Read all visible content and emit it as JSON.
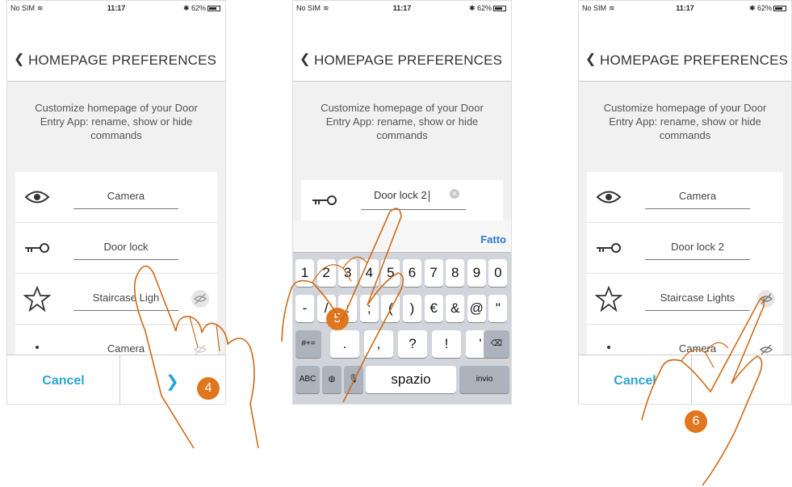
{
  "status": {
    "carrier": "No SIM",
    "time": "11:17",
    "battery": "62%"
  },
  "title": "HOMEPAGE PREFERENCES",
  "description": "Customize homepage of your Door Entry App: rename, show or hide commands",
  "screen1": {
    "items": [
      "Camera",
      "Door lock",
      "Staircase Ligh",
      "Camera"
    ],
    "cancel": "Cancel",
    "badge": "4"
  },
  "screen2": {
    "field_value": "Door lock 2",
    "done": "Fatto",
    "badge": "5",
    "keys": {
      "row1": [
        "1",
        "2",
        "3",
        "4",
        "5",
        "6",
        "7",
        "8",
        "9",
        "0"
      ],
      "row2": [
        "-",
        "/",
        ":",
        ";",
        "(",
        ")",
        "€",
        "&",
        "@",
        "\""
      ],
      "row3_left": "#+=",
      "row3": [
        ".",
        ",",
        "?",
        "!",
        "'"
      ],
      "row4_abc": "ABC",
      "space": "spazio",
      "enter": "invio"
    }
  },
  "screen3": {
    "items": [
      "Camera",
      "Door lock 2",
      "Staircase Lights",
      "Camera"
    ],
    "cancel": "Cancel",
    "badge": "6"
  }
}
